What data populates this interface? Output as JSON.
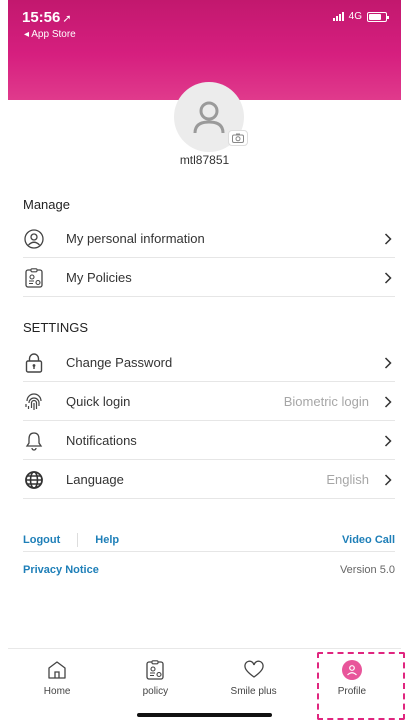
{
  "status_bar": {
    "time": "15:56",
    "back_label": "◂ App Store",
    "network": "4G"
  },
  "profile": {
    "username": "mtl87851"
  },
  "manage": {
    "title": "Manage",
    "items": [
      {
        "label": "My personal information",
        "icon": "person-circle-icon"
      },
      {
        "label": "My Policies",
        "icon": "policy-document-icon"
      }
    ]
  },
  "settings": {
    "title": "SETTINGS",
    "items": [
      {
        "label": "Change Password",
        "value": "",
        "icon": "lock-icon"
      },
      {
        "label": "Quick login",
        "value": "Biometric login",
        "icon": "fingerprint-icon"
      },
      {
        "label": "Notifications",
        "value": "",
        "icon": "bell-icon"
      },
      {
        "label": "Language",
        "value": "English",
        "icon": "globe-icon"
      }
    ]
  },
  "links": {
    "logout": "Logout",
    "help": "Help",
    "video_call": "Video Call",
    "privacy": "Privacy Notice",
    "version": "Version 5.0"
  },
  "tabbar": {
    "items": [
      {
        "label": "Home",
        "icon": "home-icon"
      },
      {
        "label": "policy",
        "icon": "policy-icon"
      },
      {
        "label": "Smile plus",
        "icon": "heart-icon"
      },
      {
        "label": "Profile",
        "icon": "profile-icon",
        "active": true
      }
    ]
  },
  "colors": {
    "brand": "#d61f7f",
    "link": "#1e7fb8",
    "highlight": "#e0257f"
  }
}
